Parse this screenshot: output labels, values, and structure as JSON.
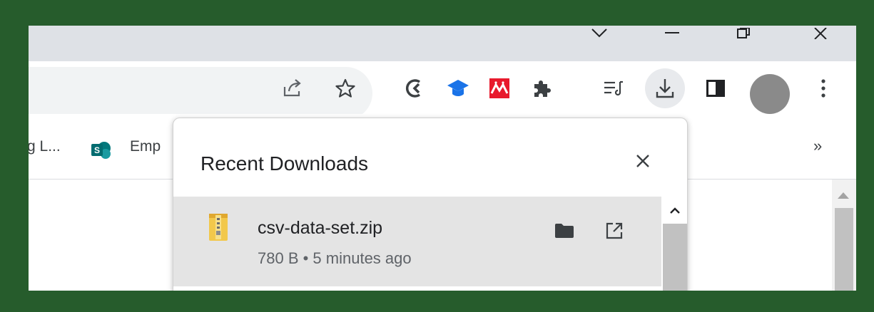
{
  "window": {
    "controls": [
      "chevron-down",
      "minimize",
      "restore",
      "close"
    ]
  },
  "toolbar": {
    "icons": [
      "share-icon",
      "star-icon",
      "extension-c-icon",
      "graduation-cap-icon",
      "red-extension-icon",
      "puzzle-icon",
      "media-list-icon",
      "download-icon",
      "side-panel-icon",
      "avatar",
      "menu-dots-icon"
    ],
    "accent_colors": {
      "cap": "#1a73e8",
      "red_ext": "#e8192c",
      "avatar": "#8a8a8a"
    }
  },
  "bookmarks": {
    "items": [
      {
        "label": "g L..."
      },
      {
        "label": "Emp"
      }
    ],
    "overflow_label": "»"
  },
  "downloads": {
    "title": "Recent Downloads",
    "items": [
      {
        "name": "csv-data-set.zip",
        "meta": "780 B • 5 minutes ago"
      }
    ]
  }
}
